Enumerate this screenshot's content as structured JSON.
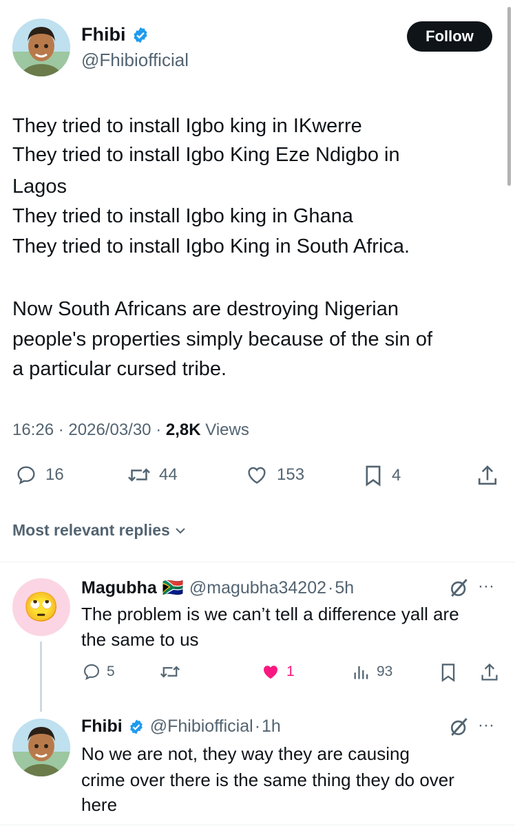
{
  "author": {
    "name": "Fhibi",
    "handle": "@Fhibiofficial",
    "verified_icon": "verified-badge-icon",
    "follow_label": "Follow"
  },
  "post": {
    "lines": [
      "They tried to install Igbo king in IKwerre",
      "They tried to install Igbo King Eze Ndigbo in",
      "Lagos",
      "They tried to install Igbo king in Ghana",
      "They tried to install Igbo King in South Africa.",
      "",
      "Now South Africans are destroying Nigerian",
      "people's properties simply because of the sin of",
      "a particular cursed tribe."
    ],
    "time": "16:26",
    "date": "2026/03/30",
    "separator": "·",
    "views_count": "2,8K",
    "views_label": "Views"
  },
  "actions": {
    "replies": "16",
    "reposts": "44",
    "likes": "153",
    "bookmarks": "4"
  },
  "replies_filter": {
    "label": "Most relevant replies"
  },
  "reply1": {
    "name": "Magubha",
    "flag": "🇿🇦",
    "handle": "@magubha34202",
    "separator": "·",
    "time": "5h",
    "lines": [
      "The problem is we can’t tell a difference yall are",
      "the same to us"
    ],
    "replies": "5",
    "reposts": "",
    "likes": "1",
    "views": "93",
    "avatar_emoji": "🙄",
    "more": "···"
  },
  "reply2": {
    "name": "Fhibi",
    "handle": "@Fhibiofficial",
    "separator": "·",
    "time": "1h",
    "lines": [
      "No we are not, they way they are causing",
      "crime over there is the same thing they do over",
      "here"
    ],
    "more": "···"
  },
  "colors": {
    "verified": "#1d9bf0",
    "liked": "#f91880",
    "text": "#0f1419",
    "muted": "#536471"
  }
}
